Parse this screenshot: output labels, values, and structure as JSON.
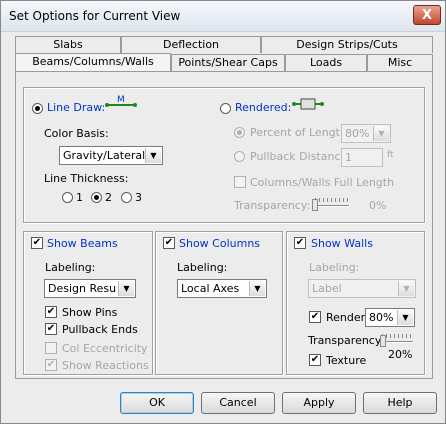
{
  "window": {
    "title": "Set Options for Current View",
    "close_glyph": "X"
  },
  "tabs": {
    "row1": [
      "Slabs",
      "Deflection",
      "Design Strips/Cuts"
    ],
    "row2": [
      "Beams/Columns/Walls",
      "Points/Shear Caps",
      "Loads",
      "Misc"
    ],
    "active": "Beams/Columns/Walls"
  },
  "display": {
    "line_draw_label": "Line Draw:",
    "line_draw_icon_label": "M",
    "rendered_label": "Rendered:",
    "color_basis_label": "Color Basis:",
    "color_basis_value": "Gravity/Lateral",
    "line_thickness_label": "Line Thickness:",
    "thickness_options": [
      "1",
      "2",
      "3"
    ],
    "thickness_selected": "2",
    "percent_length_label": "Percent of Length",
    "percent_length_value": "80%",
    "pullback_distance_label": "Pullback Distance",
    "pullback_distance_value": "1",
    "pullback_unit": "ft",
    "columns_walls_full_length_label": "Columns/Walls Full Length",
    "transparency_label": "Transparency:",
    "transparency_value": "0%"
  },
  "beams": {
    "show_label": "Show Beams",
    "labeling_label": "Labeling:",
    "labeling_value": "Design Results",
    "show_pins_label": "Show Pins",
    "pullback_ends_label": "Pullback Ends",
    "col_eccentricity_label": "Col Eccentricity",
    "show_reactions_label": "Show Reactions"
  },
  "columns": {
    "show_label": "Show Columns",
    "labeling_label": "Labeling:",
    "labeling_value": "Local Axes"
  },
  "walls": {
    "show_label": "Show Walls",
    "labeling_label": "Labeling:",
    "labeling_value": "Label",
    "render_label": "Render",
    "render_value": "80%",
    "transparency_label": "Transparency",
    "transparency_value": "20%",
    "texture_label": "Texture"
  },
  "buttons": {
    "ok": "OK",
    "cancel": "Cancel",
    "apply": "Apply",
    "help": "Help"
  },
  "checked_glyph": "✔",
  "dropdown_glyph": "▼"
}
